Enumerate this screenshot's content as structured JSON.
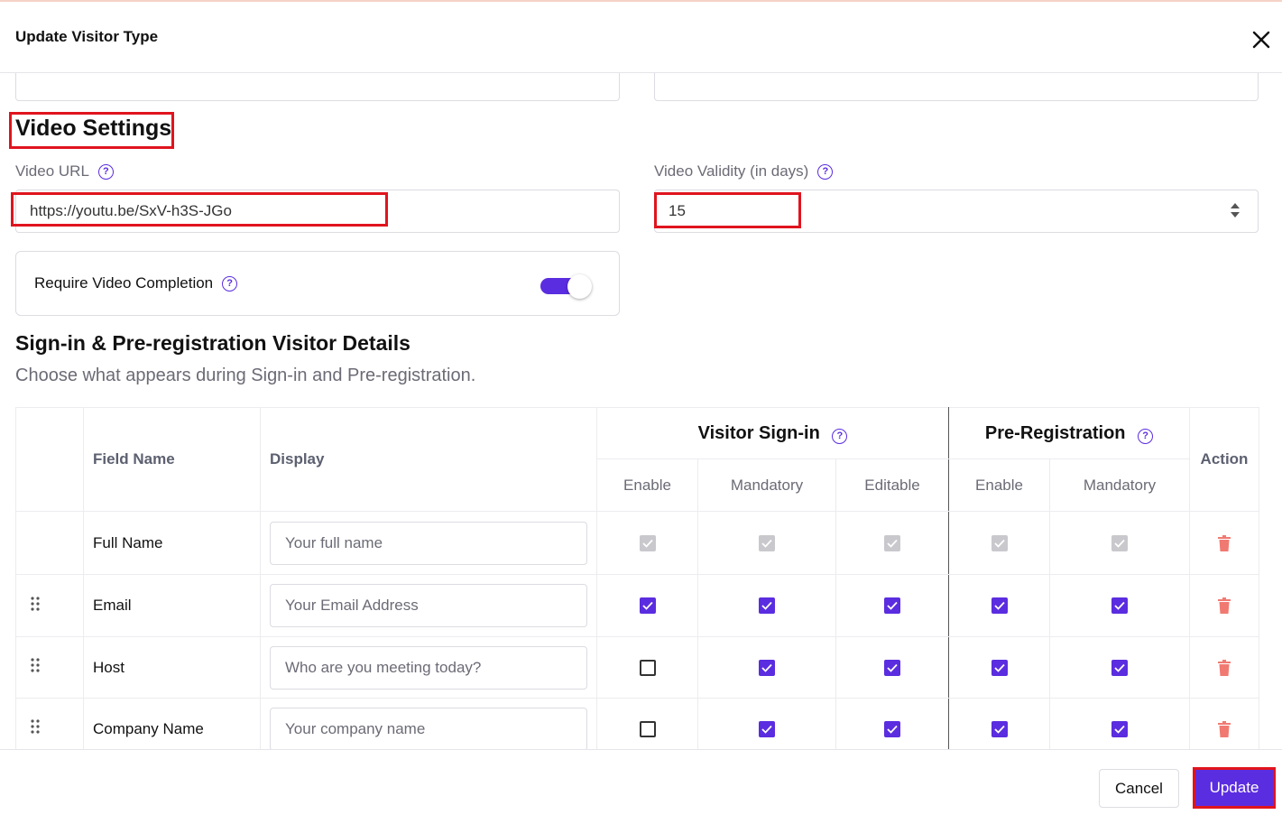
{
  "dialog": {
    "title": "Update Visitor Type"
  },
  "video": {
    "section_title": "Video Settings",
    "url_label": "Video URL",
    "url_value": "https://youtu.be/SxV-h3S-JGo",
    "validity_label": "Video Validity (in days)",
    "validity_value": "15",
    "require_label": "Require Video Completion",
    "require_enabled": true
  },
  "details": {
    "title": "Sign-in & Pre-registration Visitor Details",
    "subtitle": "Choose what appears during Sign-in and Pre-registration.",
    "headers": {
      "field_name": "Field Name",
      "display": "Display",
      "visitor_signin": "Visitor Sign-in",
      "pre_registration": "Pre-Registration",
      "action": "Action",
      "enable": "Enable",
      "mandatory": "Mandatory",
      "editable": "Editable",
      "enable2": "Enable",
      "mandatory2": "Mandatory"
    },
    "rows": [
      {
        "name": "Full Name",
        "placeholder": "Your full name",
        "draggable": false,
        "checks": [
          "disabled",
          "disabled",
          "disabled",
          "disabled",
          "disabled"
        ]
      },
      {
        "name": "Email",
        "placeholder": "Your Email Address",
        "draggable": true,
        "checks": [
          "on",
          "on",
          "on",
          "on",
          "on"
        ]
      },
      {
        "name": "Host",
        "placeholder": "Who are you meeting today?",
        "draggable": true,
        "checks": [
          "off",
          "on",
          "on",
          "on",
          "on"
        ]
      },
      {
        "name": "Company Name",
        "placeholder": "Your company name",
        "draggable": true,
        "checks": [
          "off",
          "on",
          "on",
          "on",
          "on"
        ]
      }
    ]
  },
  "footer": {
    "cancel": "Cancel",
    "update": "Update"
  },
  "colors": {
    "accent": "#5b2de0",
    "highlight": "#e0141e",
    "trash": "#f07a72"
  }
}
